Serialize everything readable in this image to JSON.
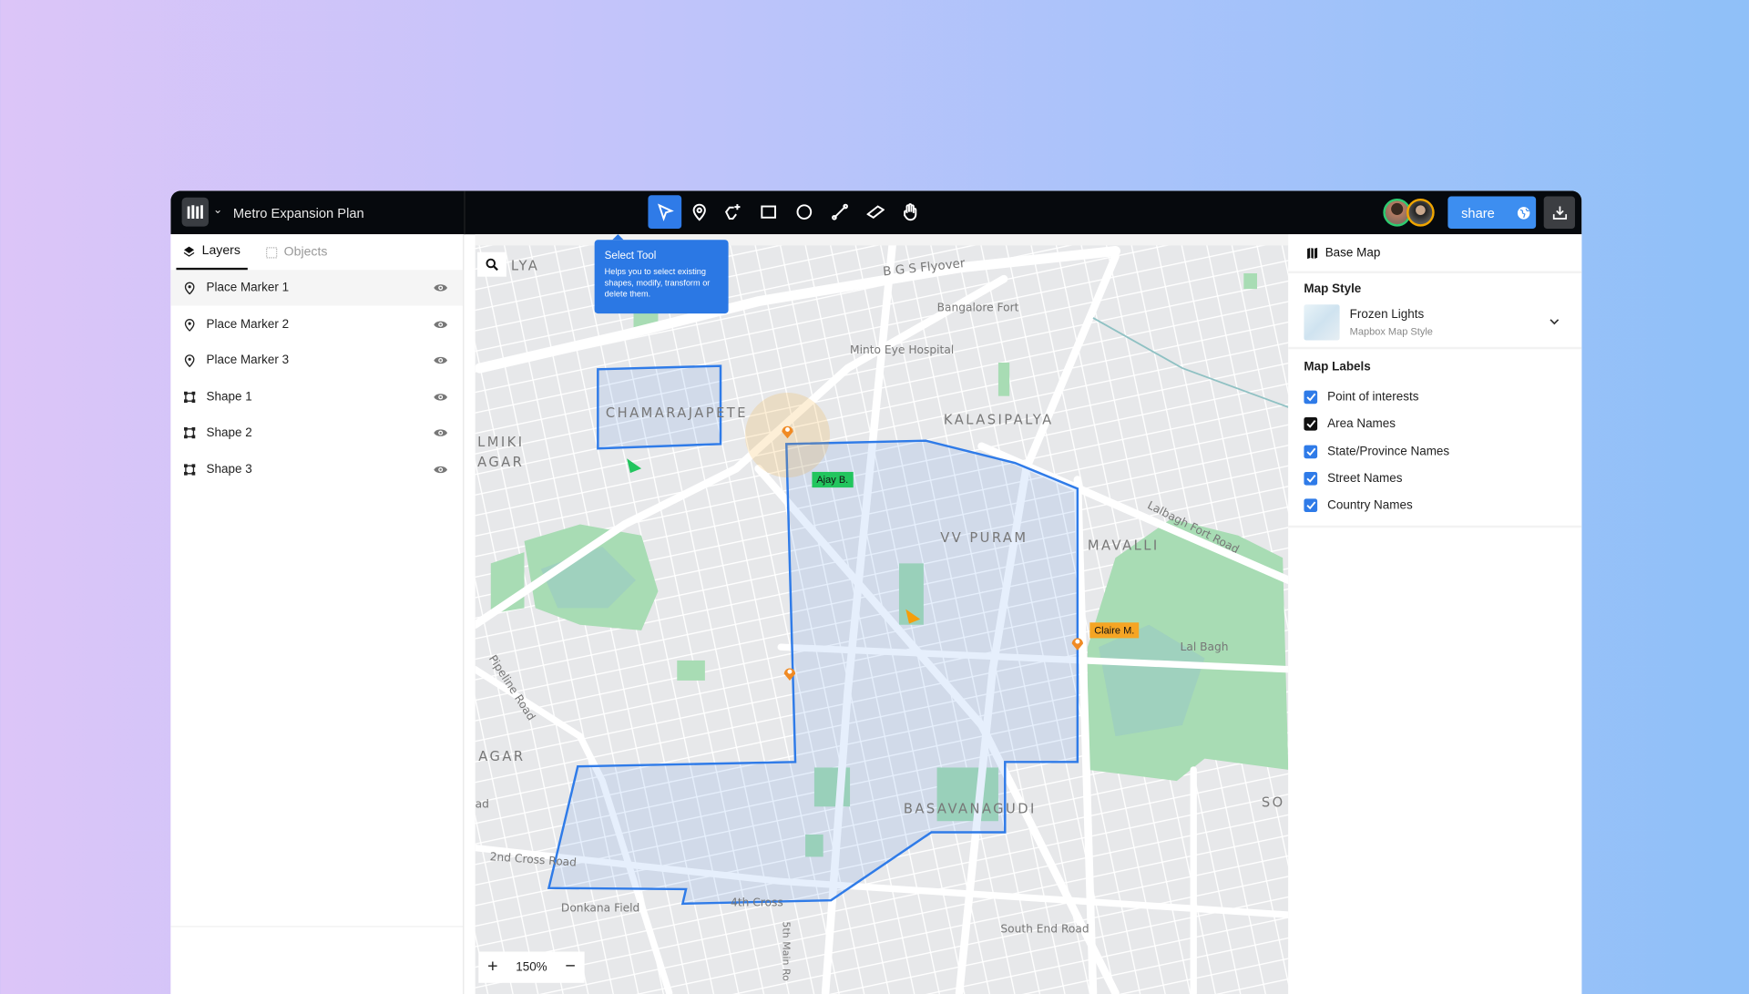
{
  "app": {
    "title": "Metro Expansion Plan",
    "logo_icon": "m-logo-icon"
  },
  "toolbar": {
    "tools": [
      "select",
      "place-marker",
      "lasso-add",
      "rectangle",
      "circle",
      "line",
      "ruler",
      "hand"
    ],
    "selected": "select",
    "share_label": "share",
    "accent": "#2f7be8"
  },
  "tooltip": {
    "title": "Select Tool",
    "body": "Helps you to select existing shapes, modify, transform or delete them."
  },
  "left_panel": {
    "tabs": [
      {
        "label": "Layers",
        "active": true
      },
      {
        "label": "Objects",
        "active": false
      }
    ],
    "layers": [
      {
        "label": "Place Marker 1",
        "type": "marker"
      },
      {
        "label": "Place Marker 2",
        "type": "marker"
      },
      {
        "label": "Place Marker 3",
        "type": "marker"
      },
      {
        "label": "Shape 1",
        "type": "shape"
      },
      {
        "label": "Shape 2",
        "type": "shape"
      },
      {
        "label": "Shape 3",
        "type": "shape"
      }
    ]
  },
  "map": {
    "labels": {
      "chamarajapete": "CHAMARAJAPETE",
      "kalasipalya": "KALASIPALYA",
      "vvpuram": "VV PURAM",
      "mavalli": "MAVALLI",
      "basavanagudi": "BASAVANAGUDI",
      "bgs": "B G S Flyover",
      "fort": "Bangalore Fort",
      "minto": "Minto Eye Hospital",
      "lalbaghroad": "Lalbagh Fort Road",
      "lalbagh": "Lal Bagh",
      "pipeline": "Pipeline Road",
      "cross2": "2nd Cross Road",
      "donkana": "Donkana Field",
      "cross4": "4th Cross",
      "southend": "South End Road",
      "main5": "5th Main Ro",
      "lmiki": "LMIKI",
      "agar1": "AGAR",
      "agar2": "AGAR",
      "so": "SO",
      "ad": "ad",
      "lya": "LYA"
    },
    "cursors": [
      {
        "name": "Ajay B.",
        "color": "#22c55e"
      },
      {
        "name": "Claire M.",
        "color": "#f59e0b"
      }
    ],
    "zoom": "150%",
    "zoom_in": "+",
    "zoom_out": "−"
  },
  "right_panel": {
    "header": "Base Map",
    "map_style_heading": "Map Style",
    "style_name": "Frozen Lights",
    "style_sub": "Mapbox Map Style",
    "labels_heading": "Map Labels",
    "labels": [
      {
        "label": "Point of interests",
        "checked": true
      },
      {
        "label": "Area Names",
        "checked": true
      },
      {
        "label": "State/Province Names",
        "checked": true
      },
      {
        "label": "Street Names",
        "checked": true
      },
      {
        "label": "Country Names",
        "checked": true
      }
    ]
  }
}
